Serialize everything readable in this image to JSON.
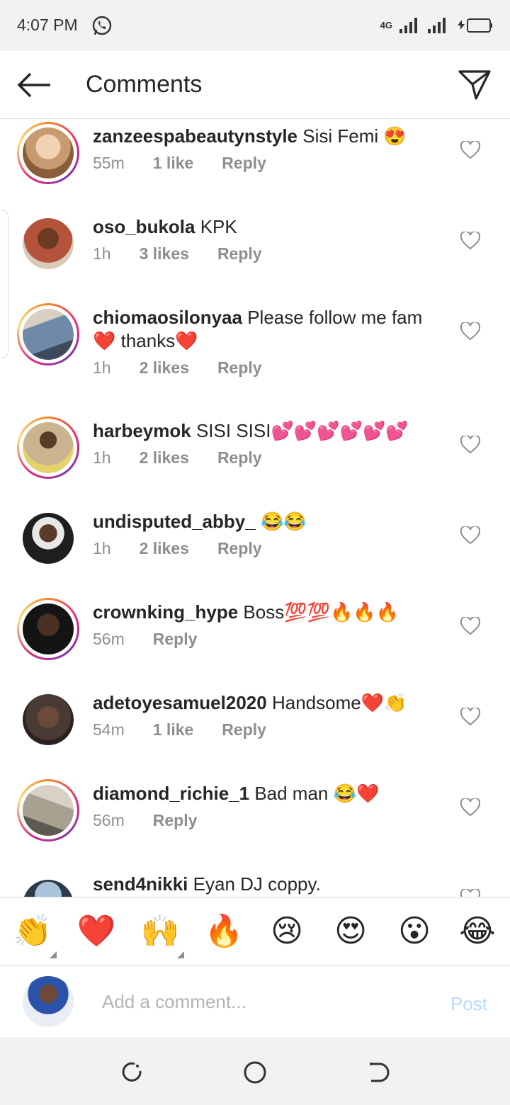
{
  "status_bar": {
    "time": "4:07 PM",
    "network": "4G"
  },
  "header": {
    "title": "Comments"
  },
  "comments": [
    {
      "username": "zanzeespabeautynstyle",
      "text": "Sisi Femi 😍",
      "time": "55m",
      "likes": "1 like",
      "reply": "Reply",
      "story": true,
      "avatar_color": "#c89a70"
    },
    {
      "username": "oso_bukola",
      "text": "KPK",
      "time": "1h",
      "likes": "3 likes",
      "reply": "Reply",
      "story": false,
      "avatar_color": "#b4523a"
    },
    {
      "username": "chiomaosilonyaa",
      "text": "Please follow me fam ❤️ thanks❤️",
      "time": "1h",
      "likes": "2 likes",
      "reply": "Reply",
      "story": true,
      "avatar_color": "#6f8aa8"
    },
    {
      "username": "harbeymok",
      "text": "SISI SISI💕💕💕💕💕💕",
      "time": "1h",
      "likes": "2 likes",
      "reply": "Reply",
      "story": true,
      "avatar_color": "#c9b48f"
    },
    {
      "username": "undisputed_abby_",
      "text": "😂😂",
      "time": "1h",
      "likes": "2 likes",
      "reply": "Reply",
      "story": false,
      "avatar_color": "#2a2a2a"
    },
    {
      "username": "crownking_hype",
      "text": "Boss💯💯🔥🔥🔥",
      "time": "56m",
      "likes": "",
      "reply": "Reply",
      "story": true,
      "avatar_color": "#141414"
    },
    {
      "username": "adetoyesamuel2020",
      "text": "Handsome❤️👏",
      "time": "54m",
      "likes": "1 like",
      "reply": "Reply",
      "story": false,
      "avatar_color": "#4a3a34"
    },
    {
      "username": "diamond_richie_1",
      "text": "Bad man 😂❤️",
      "time": "56m",
      "likes": "",
      "reply": "Reply",
      "story": true,
      "avatar_color": "#a8a091"
    },
    {
      "username": "send4nikki",
      "text": "Eyan DJ coppy.",
      "time": "",
      "likes": "",
      "reply": "",
      "story": false,
      "avatar_color": "#2c3a4a"
    }
  ],
  "emoji_bar": [
    "👏",
    "❤️",
    "🙌",
    "🔥",
    "😢",
    "😍",
    "😮",
    "😂"
  ],
  "composer": {
    "placeholder": "Add a comment...",
    "post_label": "Post",
    "avatar_color": "#3b4f86"
  },
  "colors": {
    "text": "#262626",
    "meta": "#8e8e8e",
    "post_disabled": "#b3dbff"
  }
}
